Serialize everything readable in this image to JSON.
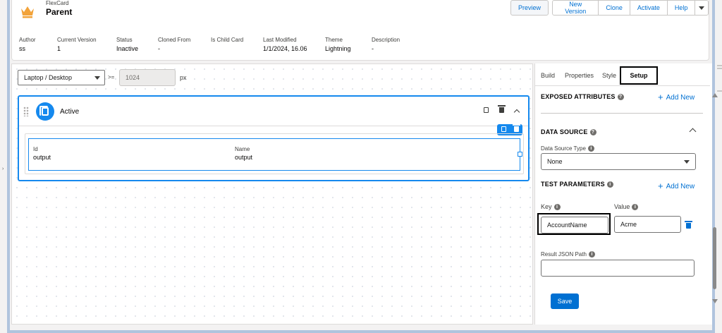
{
  "header": {
    "object_type": "FlexCard",
    "title": "Parent",
    "buttons": {
      "preview": "Preview",
      "new_version": "New Version",
      "clone": "Clone",
      "activate": "Activate",
      "help": "Help"
    },
    "meta": [
      {
        "label": "Author",
        "value": "ss"
      },
      {
        "label": "Current Version",
        "value": "1"
      },
      {
        "label": "Status",
        "value": "Inactive"
      },
      {
        "label": "Cloned From",
        "value": "-"
      },
      {
        "label": "Is Child Card",
        "value": ""
      },
      {
        "label": "Last Modified",
        "value": "1/1/2024, 16.06"
      },
      {
        "label": "Theme",
        "value": "Lightning"
      },
      {
        "label": "Description",
        "value": "-"
      }
    ]
  },
  "canvas": {
    "device": "Laptop / Desktop",
    "gte": ">=",
    "width_value": "1024",
    "unit": "px",
    "state": {
      "name": "Active",
      "fields": [
        {
          "label": "Id",
          "value": "output"
        },
        {
          "label": "Name",
          "value": "output"
        }
      ]
    }
  },
  "panel": {
    "tabs": {
      "build": "Build",
      "properties": "Properties",
      "style": "Style",
      "setup": "Setup"
    },
    "exposed_attributes": {
      "title": "EXPOSED ATTRIBUTES",
      "add": "Add New"
    },
    "data_source": {
      "title": "DATA SOURCE",
      "type_label": "Data Source Type",
      "type_value": "None"
    },
    "test_parameters": {
      "title": "TEST PARAMETERS",
      "add": "Add New",
      "key_label": "Key",
      "value_label": "Value",
      "key": "AccountName",
      "value": "Acme"
    },
    "result_json_path": {
      "label": "Result JSON Path",
      "value": ""
    },
    "save": "Save"
  },
  "colors": {
    "accent": "#0070d2",
    "brand_blue": "#1589ee",
    "logo_orange": "#f2a33a"
  }
}
